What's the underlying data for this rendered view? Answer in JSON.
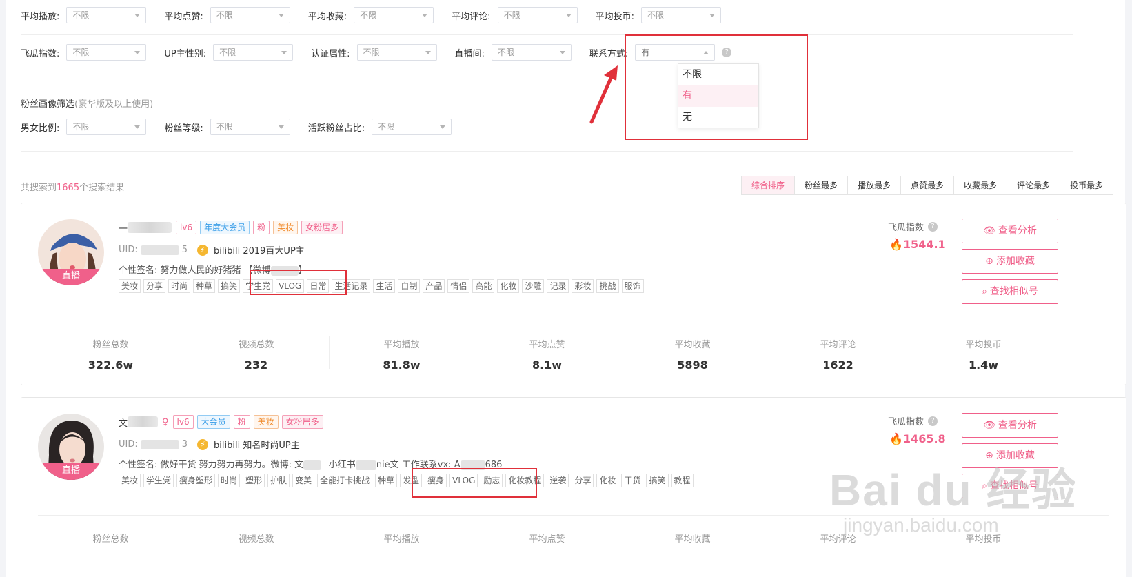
{
  "filters_row1": [
    {
      "label": "平均播放:",
      "value": "不限"
    },
    {
      "label": "平均点赞:",
      "value": "不限"
    },
    {
      "label": "平均收藏:",
      "value": "不限"
    },
    {
      "label": "平均评论:",
      "value": "不限"
    },
    {
      "label": "平均投币:",
      "value": "不限"
    }
  ],
  "filters_row2": [
    {
      "label": "飞瓜指数:",
      "value": "不限"
    },
    {
      "label": "UP主性别:",
      "value": "不限"
    },
    {
      "label": "认证属性:",
      "value": "不限"
    },
    {
      "label": "直播间:",
      "value": "不限"
    },
    {
      "label": "联系方式:",
      "value": "有"
    }
  ],
  "contact_dropdown": {
    "options": [
      "不限",
      "有",
      "无"
    ],
    "selected": "有"
  },
  "fans_filter": {
    "title": "粉丝画像筛选",
    "note": "(豪华版及以上使用)",
    "filters": [
      {
        "label": "男女比例:",
        "value": "不限"
      },
      {
        "label": "粉丝等级:",
        "value": "不限"
      },
      {
        "label": "活跃粉丝占比:",
        "value": "不限"
      }
    ]
  },
  "results": {
    "prefix": "共搜索到",
    "count": "1665",
    "suffix": "个搜索结果"
  },
  "sort_tabs": [
    "综合排序",
    "粉丝最多",
    "播放最多",
    "点赞最多",
    "收藏最多",
    "评论最多",
    "投币最多"
  ],
  "actions": {
    "analyze": "查看分析",
    "favorite": "添加收藏",
    "similar": "查找相似号"
  },
  "fly_index_label": "飞瓜指数",
  "live_label": "直播",
  "uid_prefix": "UID:",
  "stat_labels": [
    "粉丝总数",
    "视频总数",
    "平均播放",
    "平均点赞",
    "平均收藏",
    "平均评论",
    "平均投币"
  ],
  "cards": [
    {
      "name_prefix": "一",
      "uid_suffix": "5",
      "tags": [
        "lv6",
        "年度大会员",
        "粉",
        "美妆",
        "女粉居多"
      ],
      "badge": "bilibili 2019百大UP主",
      "signature_pre": "个性签名: 努力做人民的好猪猪 【微博",
      "signature_post": "】",
      "keywords": [
        "美妆",
        "分享",
        "时尚",
        "种草",
        "搞笑",
        "学生党",
        "VLOG",
        "日常",
        "生活记录",
        "生活",
        "自制",
        "产品",
        "情侣",
        "高能",
        "化妆",
        "沙雕",
        "记录",
        "彩妆",
        "挑战",
        "服饰"
      ],
      "fly_index": "1544.1",
      "stats": [
        "322.6w",
        "232",
        "81.8w",
        "8.1w",
        "5898",
        "1622",
        "1.4w"
      ]
    },
    {
      "name_prefix": "文",
      "uid_suffix": "3",
      "tags": [
        "lv6",
        "大会员",
        "粉",
        "美妆",
        "女粉居多"
      ],
      "badge": "bilibili 知名时尚UP主",
      "signature_pre": "个性签名: 做好干货 努力努力再努力。微博: 文",
      "signature_mid": "_ 小红书",
      "signature_mid2": "nie文 工作联系vx: A",
      "signature_post": "686",
      "keywords": [
        "美妆",
        "学生党",
        "瘦身塑形",
        "时尚",
        "塑形",
        "护肤",
        "变美",
        "全能打卡挑战",
        "种草",
        "发型",
        "瘦身",
        "VLOG",
        "励志",
        "化妆教程",
        "逆袭",
        "分享",
        "化妆",
        "干货",
        "搞笑",
        "教程"
      ],
      "fly_index": "1465.8"
    }
  ],
  "watermark": {
    "main": "Bai du 经验",
    "sub": "jingyan.baidu.com"
  },
  "colors": {
    "accent": "#f0608a",
    "highlight_box": "#e0303a"
  }
}
